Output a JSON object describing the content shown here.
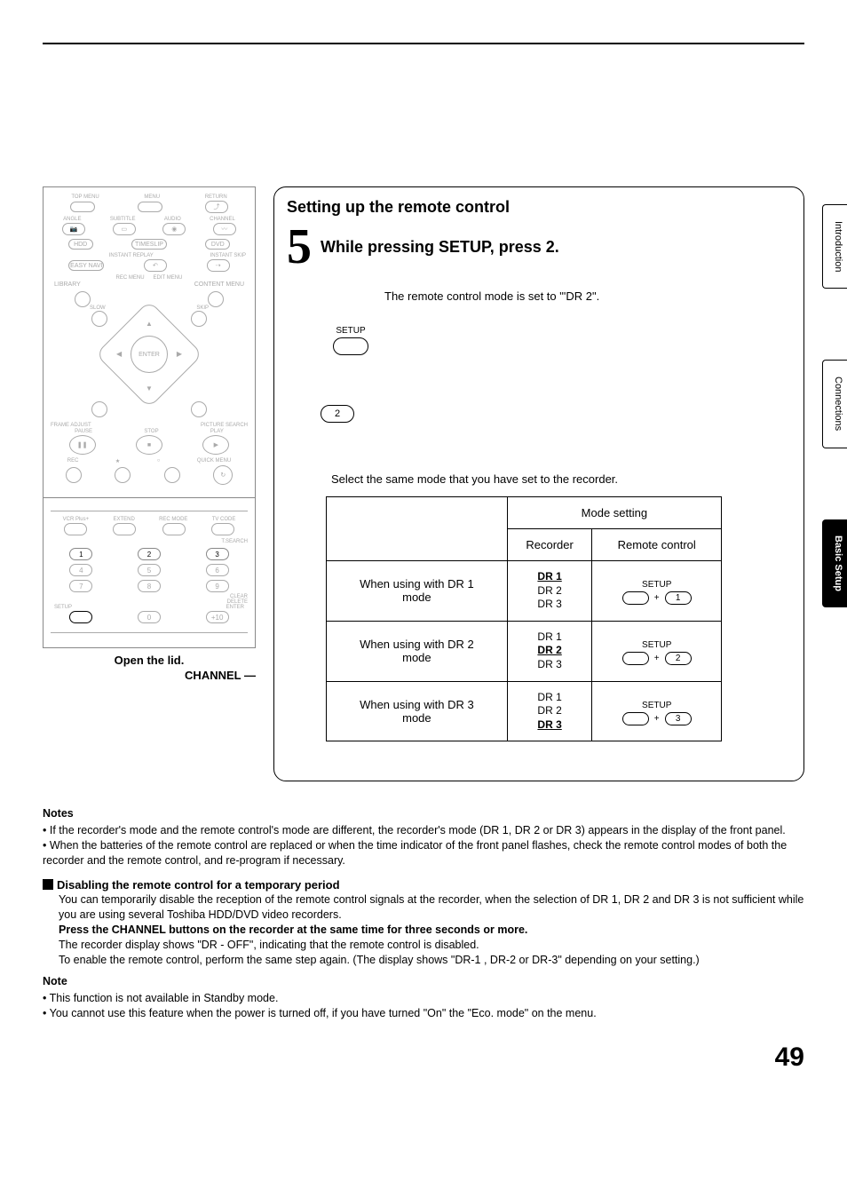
{
  "sideTabs": {
    "introduction": "Introduction",
    "connections": "Connections",
    "basicSetup": "Basic Setup"
  },
  "remote": {
    "row1": {
      "topMenu": "TOP MENU",
      "menu": "MENU",
      "return": "RETURN"
    },
    "row2": {
      "angle": "ANGLE",
      "subtitle": "SUBTITLE",
      "audio": "AUDIO",
      "channel": "CHANNEL"
    },
    "row3": {
      "hdd": "HDD",
      "timeslip": "TIMESLIP",
      "dvd": "DVD"
    },
    "row4": {
      "easyNavi": "EASY NAVI",
      "instantReplay": "INSTANT REPLAY",
      "instantSkip": "INSTANT SKIP"
    },
    "row5": {
      "recMenu": "REC MENU",
      "editMenu": "EDIT MENU"
    },
    "library": "LIBRARY",
    "contentMenu": "CONTENT MENU",
    "slow": "SLOW",
    "skip": "SKIP",
    "enter": "ENTER",
    "frame": "FRAME",
    "adjust": "ADJUST",
    "pictureSearch": "PICTURE SEARCH",
    "pause": "PAUSE",
    "stop": "STOP",
    "play": "PLAY",
    "rec": "REC",
    "quickMenu": "QUICK MENU",
    "openLid": "Open the lid.",
    "channelLbl": "CHANNEL",
    "vcrPlus": "VCR Plus+",
    "extend": "EXTEND",
    "recMode": "REC MODE",
    "tvCode": "TV CODE",
    "tSearch": "T.SEARCH",
    "clear": "CLEAR",
    "delete": "DELETE",
    "setup": "SETUP",
    "enterSmall": "ENTER",
    "keys": {
      "k1": "1",
      "k2": "2",
      "k3": "3",
      "k4": "4",
      "k5": "5",
      "k6": "6",
      "k7": "7",
      "k8": "8",
      "k9": "9",
      "k0": "0",
      "k10": "+10"
    }
  },
  "main": {
    "sectionTitle": "Setting up the remote control",
    "stepNum": "5",
    "stepText": "While pressing SETUP, press 2.",
    "resultText": "The remote control mode is set to \"'DR 2\".",
    "setupLabel": "SETUP",
    "num2": "2",
    "selectText": "Select the same mode that you have set to the recorder.",
    "table": {
      "headerMode": "Mode setting",
      "headerRecorder": "Recorder",
      "headerRemote": "Remote control",
      "rows": [
        {
          "label1": "When using with DR 1",
          "label2": "mode",
          "dr": [
            "DR 1",
            "DR 2",
            "DR 3"
          ],
          "boldIdx": 0,
          "num": "1"
        },
        {
          "label1": "When using with DR 2",
          "label2": "mode",
          "dr": [
            "DR 1",
            "DR 2",
            "DR 3"
          ],
          "boldIdx": 1,
          "num": "2"
        },
        {
          "label1": "When using with DR 3",
          "label2": "mode",
          "dr": [
            "DR 1",
            "DR 2",
            "DR 3"
          ],
          "boldIdx": 2,
          "num": "3"
        }
      ],
      "setupSmall": "SETUP",
      "plus": "+"
    }
  },
  "notes": {
    "heading1": "Notes",
    "n1": "If the recorder's mode and the remote control's mode are different, the recorder's mode (DR 1, DR 2 or DR 3) appears in the display of the front panel.",
    "n2": "When the batteries of the remote control are replaced or when the time indicator of the front panel flashes, check the remote control modes of both the recorder and the remote control, and re-program if necessary.",
    "subhead": "Disabling the remote control for a temporary period",
    "p1": "You can temporarily disable the reception of the remote control signals at the recorder, when the selection of DR 1, DR 2 and DR 3 is not sufficient while you are using several Toshiba HDD/DVD video recorders.",
    "p2": "Press the CHANNEL buttons on the recorder at the same time for three seconds or more.",
    "p3": "The recorder display shows \"DR - OFF\", indicating that the remote control is disabled.",
    "p4": "To enable the remote control, perform the same step again. (The display shows \"DR-1 , DR-2 or DR-3\" depending on your setting.)",
    "heading2": "Note",
    "n3": "This function is not available in Standby mode.",
    "n4": "You cannot use this feature when the power is turned off, if you have turned \"On\" the \"Eco. mode\" on the menu."
  },
  "pageNumber": "49"
}
